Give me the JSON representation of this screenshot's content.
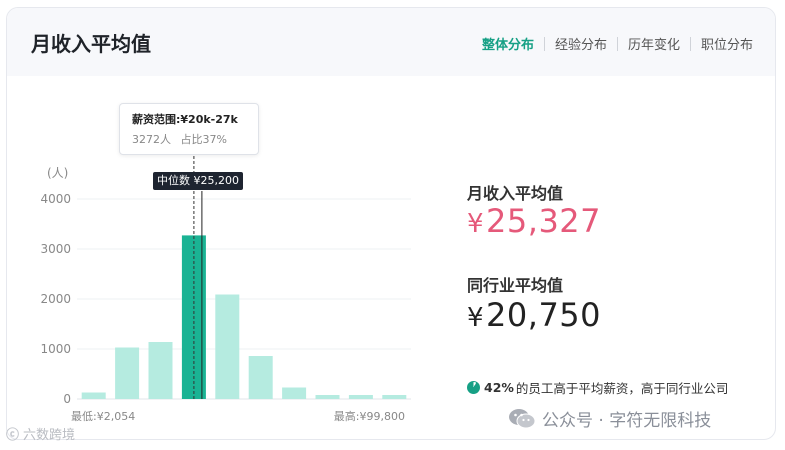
{
  "header": {
    "title": "月收入平均值",
    "tabs": [
      {
        "label": "整体分布",
        "active": true
      },
      {
        "label": "经验分布",
        "active": false
      },
      {
        "label": "历年变化",
        "active": false
      },
      {
        "label": "职位分布",
        "active": false
      }
    ]
  },
  "chart_data": {
    "type": "bar",
    "ylabel": "(人)",
    "ylim": [
      0,
      4000
    ],
    "yticks": [
      "4000",
      "3000",
      "2000",
      "1000",
      "0"
    ],
    "xlabel_min": "最低:¥2,054",
    "xlabel_max": "最高:¥99,800",
    "values": [
      130,
      1030,
      1140,
      3272,
      2090,
      860,
      230,
      80,
      80,
      80
    ],
    "highlight_index": 3,
    "tooltip": {
      "range": "薪资范围:¥20k-27k",
      "count": "3272人",
      "share": "占比37%"
    },
    "median_label": "中位数 ¥25,200",
    "colors": {
      "bar": "#b5ebe0",
      "highlight": "#1ab394"
    }
  },
  "stats": {
    "avg_label": "月收入平均值",
    "avg_currency": "¥",
    "avg_value": "25,327",
    "industry_label": "同行业平均值",
    "industry_currency": "¥",
    "industry_value": "20,750",
    "note_pct": "42%",
    "note_text": "的员工高于平均薪资，高于同行业公司"
  },
  "watermarks": {
    "right": "公众号 · 字符无限科技",
    "left_logo": "ⓒ",
    "left_text": "六数跨境"
  }
}
